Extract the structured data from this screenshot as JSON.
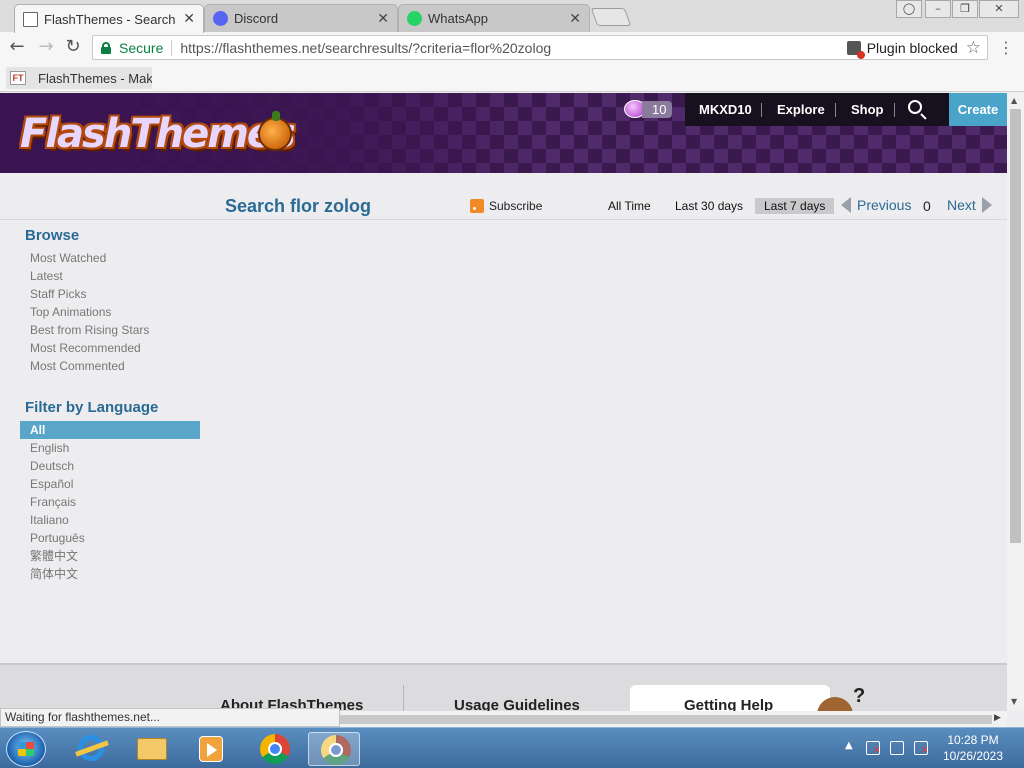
{
  "browser": {
    "tabs": [
      {
        "title": "FlashThemes - Search flor zolog",
        "active": true,
        "icon": "page-icon"
      },
      {
        "title": "Discord",
        "active": false,
        "icon": "discord-icon"
      },
      {
        "title": "WhatsApp",
        "active": false,
        "icon": "whatsapp-icon"
      }
    ],
    "secure_label": "Secure",
    "url": "https://flashthemes.net/searchresults/?criteria=flor%20zolog",
    "plugin_blocked_label": "Plugin blocked",
    "bookmarks": [
      {
        "label": "FlashThemes - Make",
        "icon_text": "FT"
      }
    ],
    "status_text": "Waiting for flashthemes.net..."
  },
  "site": {
    "logo_text": "FlashThemes",
    "coins": "10",
    "nav": {
      "user": "MKXD10",
      "explore": "Explore",
      "shop": "Shop",
      "create": "Create"
    },
    "page_title": "Search flor zolog",
    "subscribe_label": "Subscribe",
    "time_filters": [
      {
        "label": "All Time",
        "active": false
      },
      {
        "label": "Last 30 days",
        "active": false
      },
      {
        "label": "Last 7 days",
        "active": true
      }
    ],
    "pager": {
      "previous": "Previous",
      "current": "0",
      "next": "Next"
    },
    "browse": {
      "heading": "Browse",
      "items": [
        "Most Watched",
        "Latest",
        "Staff Picks",
        "Top Animations",
        "Best from Rising Stars",
        "Most Recommended",
        "Most Commented"
      ]
    },
    "language": {
      "heading": "Filter by Language",
      "items": [
        "All",
        "English",
        "Deutsch",
        "Español",
        "Français",
        "Italiano",
        "Português",
        "繁體中文",
        "简体中文"
      ],
      "selected": "All"
    },
    "footer": {
      "about": "About FlashThemes",
      "guidelines": "Usage Guidelines",
      "help": "Getting Help",
      "help_mark": "?"
    }
  },
  "taskbar": {
    "apps": [
      "internet-explorer-icon",
      "file-explorer-icon",
      "media-player-icon",
      "chrome-icon",
      "chrome-window-icon"
    ],
    "time": "10:28 PM",
    "date": "10/26/2023"
  }
}
